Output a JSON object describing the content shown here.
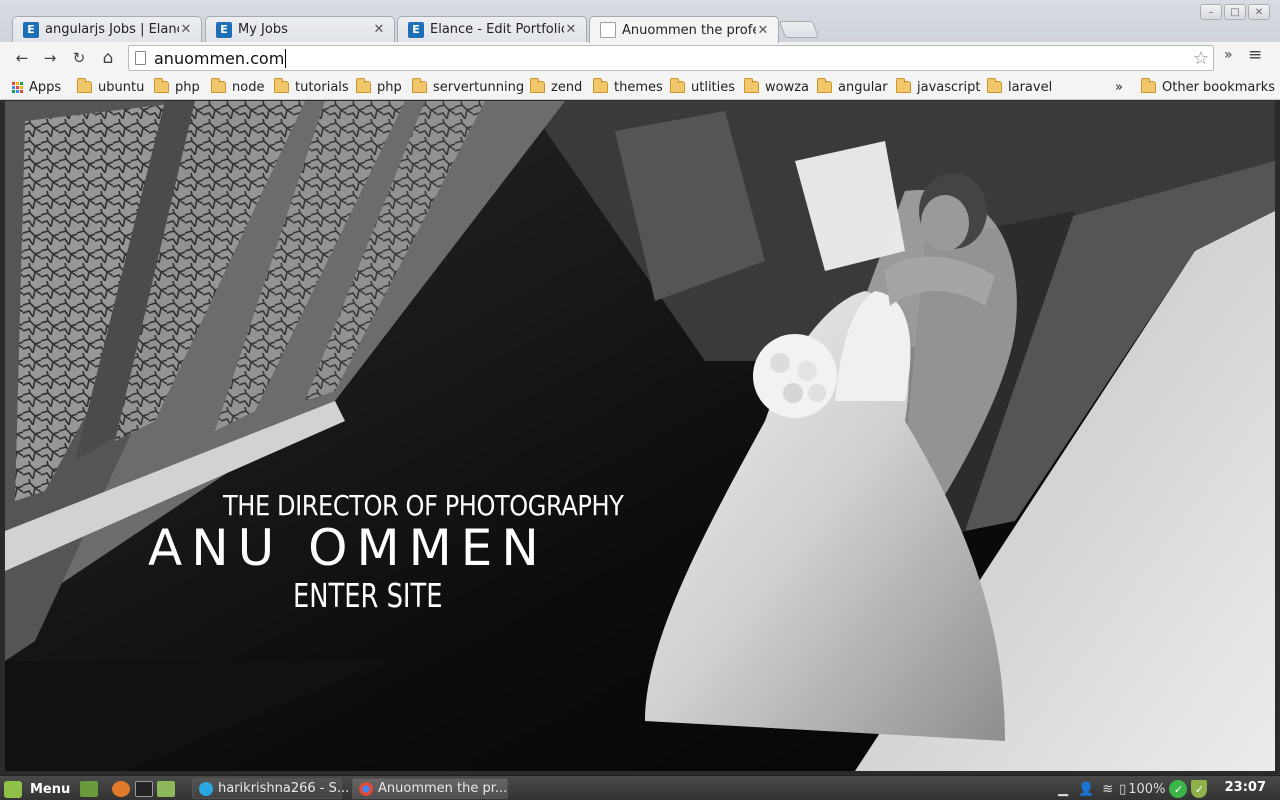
{
  "window": {
    "buttons": [
      "minimize-icon",
      "maximize-icon",
      "close-icon"
    ]
  },
  "tabs": [
    {
      "title": "angularjs Jobs | Elance",
      "favicon": "E",
      "active": false
    },
    {
      "title": "My Jobs",
      "favicon": "E",
      "active": false
    },
    {
      "title": "Elance - Edit Portfolio",
      "favicon": "E",
      "active": false
    },
    {
      "title": "Anuommen the profes",
      "favicon": "",
      "active": true
    }
  ],
  "toolbar": {
    "back": "←",
    "forward": "→",
    "reload": "↻",
    "home": "⌂",
    "url": "anuommen.com",
    "star": "☆",
    "overflow": "»",
    "menu": "≡"
  },
  "bookmarks": {
    "apps_label": "Apps",
    "items": [
      "ubuntu",
      "php",
      "node",
      "tutorials",
      "php",
      "servertunning",
      "zend",
      "themes",
      "utlities",
      "wowza",
      "angular",
      "javascript",
      "laravel"
    ],
    "overflow": "»",
    "other_label": "Other bookmarks"
  },
  "page": {
    "subtitle": "THE DIRECTOR OF PHOTOGRAPHY",
    "name": "ANU OMMEN",
    "enter": "ENTER SITE"
  },
  "taskbar": {
    "menu_label": "Menu",
    "tasks": [
      {
        "label": "harikrishna266 - S...",
        "icon": "skype-icon",
        "color": "#2aa7e0"
      },
      {
        "label": "Anuommen the pr...",
        "icon": "chrome-icon",
        "color": "#e04a3a"
      }
    ],
    "battery": "100%",
    "clock": "23:07"
  },
  "colors": {
    "brand_blue": "#1f6fb5",
    "folder": "#f2c66a",
    "mint_green": "#8fc04a"
  }
}
